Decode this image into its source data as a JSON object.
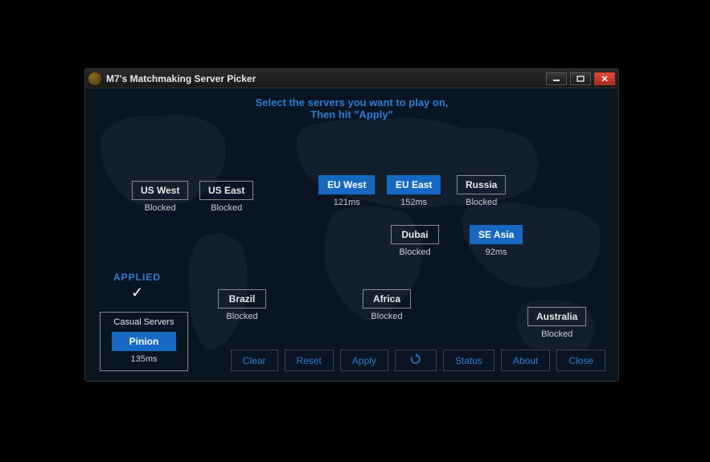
{
  "window": {
    "title": "M7's Matchmaking Server Picker"
  },
  "instructions": {
    "line1": "Select the servers you want to play on,",
    "line2": "Then hit \"Apply\""
  },
  "servers": {
    "us_west": {
      "label": "US West",
      "status": "Blocked",
      "selected": false
    },
    "us_east": {
      "label": "US East",
      "status": "Blocked",
      "selected": false
    },
    "eu_west": {
      "label": "EU West",
      "status": "121ms",
      "selected": true
    },
    "eu_east": {
      "label": "EU East",
      "status": "152ms",
      "selected": true
    },
    "russia": {
      "label": "Russia",
      "status": "Blocked",
      "selected": false
    },
    "dubai": {
      "label": "Dubai",
      "status": "Blocked",
      "selected": false
    },
    "se_asia": {
      "label": "SE Asia",
      "status": "92ms",
      "selected": true
    },
    "brazil": {
      "label": "Brazil",
      "status": "Blocked",
      "selected": false
    },
    "africa": {
      "label": "Africa",
      "status": "Blocked",
      "selected": false
    },
    "australia": {
      "label": "Australia",
      "status": "Blocked",
      "selected": false
    }
  },
  "applied": {
    "label": "APPLIED"
  },
  "casual": {
    "title": "Casual Servers",
    "pinion": {
      "label": "Pinion",
      "status": "135ms",
      "selected": true
    }
  },
  "actions": {
    "clear": "Clear",
    "reset": "Reset",
    "apply": "Apply",
    "refresh_icon": "↻",
    "status": "Status",
    "about": "About",
    "close": "Close"
  }
}
